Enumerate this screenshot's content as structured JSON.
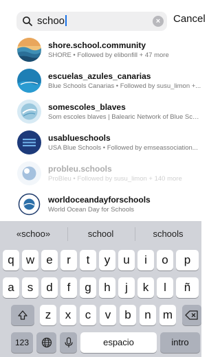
{
  "search": {
    "query": "schoo",
    "cancel_label": "Cancel"
  },
  "results": [
    {
      "name": "shore.school.community",
      "subtitle": "SHORE • Followed by elibonfill + 47 more",
      "dimmed": false
    },
    {
      "name": "escuelas_azules_canarias",
      "subtitle": "Blue Schools Canarias • Followed by susu_limon +...",
      "dimmed": false
    },
    {
      "name": "somescoles_blaves",
      "subtitle": "Som escoles blaves | Balearic Network of Blue Sch...",
      "dimmed": false
    },
    {
      "name": "usablueschools",
      "subtitle": "USA Blue Schools • Followed by emseassociation...",
      "dimmed": false
    },
    {
      "name": "probleu.schools",
      "subtitle": "ProBleu • Followed by susu_limon + 140 more",
      "dimmed": true
    },
    {
      "name": "worldoceandayforschools",
      "subtitle": "World Ocean Day for Schools",
      "dimmed": false
    }
  ],
  "keyboard": {
    "suggestions": [
      "«schoo»",
      "school",
      "schools"
    ],
    "row1": [
      "q",
      "w",
      "e",
      "r",
      "t",
      "y",
      "u",
      "i",
      "o",
      "p"
    ],
    "row2": [
      "a",
      "s",
      "d",
      "f",
      "g",
      "h",
      "j",
      "k",
      "l",
      "ñ"
    ],
    "row3": [
      "z",
      "x",
      "c",
      "v",
      "b",
      "n",
      "m"
    ],
    "shift_icon": "shift-icon",
    "delete_icon": "delete-icon",
    "numbers_label": "123",
    "globe_icon": "globe-icon",
    "mic_icon": "microphone-icon",
    "space_label": "espacio",
    "return_label": "intro"
  }
}
